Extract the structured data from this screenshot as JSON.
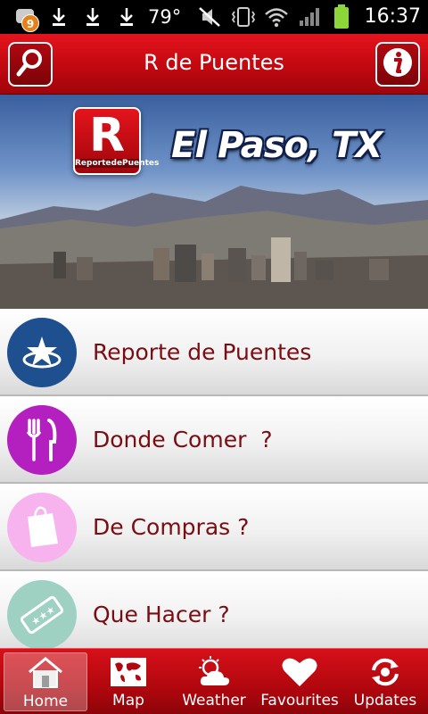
{
  "status_bar": {
    "notification_count": "9",
    "temperature": "79°",
    "time": "16:37",
    "icons": [
      "notification-icon",
      "download-icon",
      "download-icon",
      "download-icon",
      "mute-icon",
      "vibrate-icon",
      "wifi-icon",
      "signal-icon",
      "battery-icon"
    ]
  },
  "header": {
    "title": "R de Puentes",
    "search_icon": "search-icon",
    "info_icon": "info-icon"
  },
  "banner": {
    "logo_letter": "R",
    "logo_caption": "ReportedePuentes",
    "city": "El Paso, TX"
  },
  "menu": {
    "items": [
      {
        "label": "Reporte de Puentes",
        "icon": "star-icon",
        "color": "#1e4f8f"
      },
      {
        "label": "Donde Comer  ?",
        "icon": "fork-knife-icon",
        "color": "#b41fbf"
      },
      {
        "label": "De Compras ?",
        "icon": "shopping-bag-icon",
        "color": "#f6b3ee"
      },
      {
        "label": "Que Hacer ?",
        "icon": "ticket-icon",
        "color": "#9fd1c2"
      }
    ]
  },
  "tabs": {
    "items": [
      {
        "label": "Home",
        "icon": "home-icon",
        "active": true
      },
      {
        "label": "Map",
        "icon": "map-icon",
        "active": false
      },
      {
        "label": "Weather",
        "icon": "weather-icon",
        "active": false
      },
      {
        "label": "Favourites",
        "icon": "heart-icon",
        "active": false
      },
      {
        "label": "Updates",
        "icon": "refresh-icon",
        "active": false
      }
    ]
  },
  "colors": {
    "brand_red": "#c20810",
    "menu_text": "#7a0c12"
  }
}
